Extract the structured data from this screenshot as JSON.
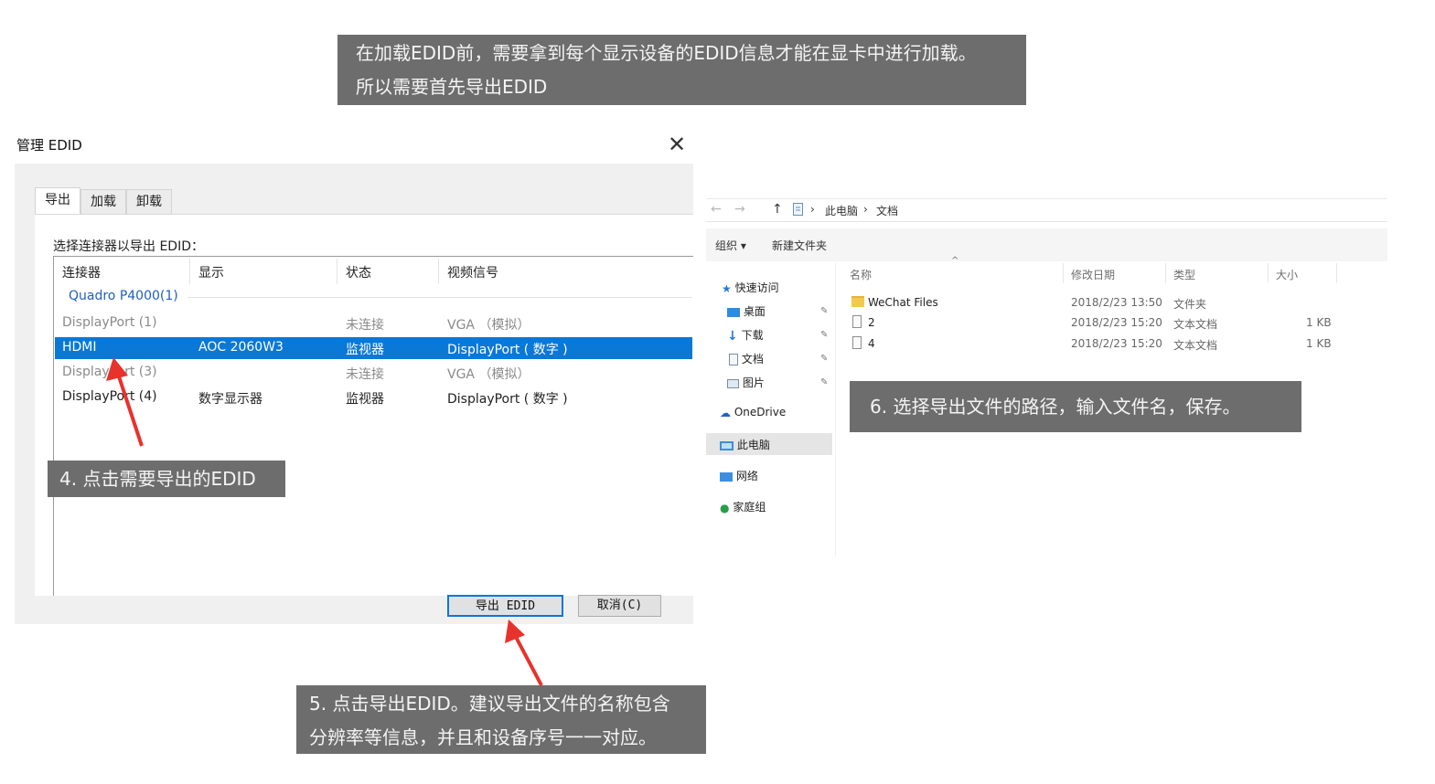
{
  "callouts": {
    "top_line1": "在加载EDID前，需要拿到每个显示设备的EDID信息才能在显卡中进行加载。",
    "top_line2": "所以需要首先导出EDID",
    "step4": "4. 点击需要导出的EDID",
    "step5_line1": "5. 点击导出EDID。建议导出文件的名称包含",
    "step5_line2": "分辨率等信息，并且和设备序号一一对应。",
    "step6": "6. 选择导出文件的路径，输入文件名，保存。"
  },
  "dialog": {
    "title": "管理 EDID",
    "close": "✕",
    "tabs": [
      {
        "label": "导出",
        "active": true
      },
      {
        "label": "加载",
        "active": false
      },
      {
        "label": "卸载",
        "active": false
      }
    ],
    "select_label": "选择连接器以导出 EDID：",
    "columns": [
      "连接器",
      "显示",
      "状态",
      "视频信号"
    ],
    "group": "Quadro P4000(1)",
    "rows": [
      {
        "connector": "DisplayPort (1)",
        "display": "",
        "status": "未连接",
        "signal": "VGA （模拟）",
        "state": "dim"
      },
      {
        "connector": "HDMI",
        "display": "AOC 2060W3",
        "status": "监视器",
        "signal": "DisplayPort ( 数字 )",
        "state": "selected"
      },
      {
        "connector": "DisplayPort (3)",
        "display": "",
        "status": "未连接",
        "signal": "VGA （模拟）",
        "state": "dim"
      },
      {
        "connector": "DisplayPort (4)",
        "display": "数字显示器",
        "status": "监视器",
        "signal": "DisplayPort ( 数字 )",
        "state": "normal"
      }
    ],
    "export_button": "导出 EDID",
    "cancel_button": "取消(C)"
  },
  "explorer": {
    "back": "←",
    "forward": "→",
    "up": "↑",
    "path": [
      "此电脑",
      "文档"
    ],
    "toolbar": {
      "organize": "组织 ▾",
      "new_folder": "新建文件夹"
    },
    "nav": {
      "quick_access": "快速访问",
      "desktop": "桌面",
      "downloads": "下载",
      "documents": "文档",
      "pictures": "图片",
      "onedrive": "OneDrive",
      "this_pc": "此电脑",
      "network": "网络",
      "homegroup": "家庭组"
    },
    "headers": {
      "name": "名称",
      "date": "修改日期",
      "type": "类型",
      "size": "大小"
    },
    "files": [
      {
        "name": "WeChat Files",
        "date": "2018/2/23 13:50",
        "type": "文件夹",
        "size": "",
        "icon": "folder-icon"
      },
      {
        "name": "2",
        "date": "2018/2/23 15:20",
        "type": "文本文档",
        "size": "1 KB",
        "icon": "text-file-icon"
      },
      {
        "name": "4",
        "date": "2018/2/23 15:20",
        "type": "文本文档",
        "size": "1 KB",
        "icon": "text-file-icon"
      }
    ]
  },
  "colors": {
    "selection": "#0a78d7",
    "callout_bg": "#6d6d6d",
    "arrow": "#e8322c"
  }
}
